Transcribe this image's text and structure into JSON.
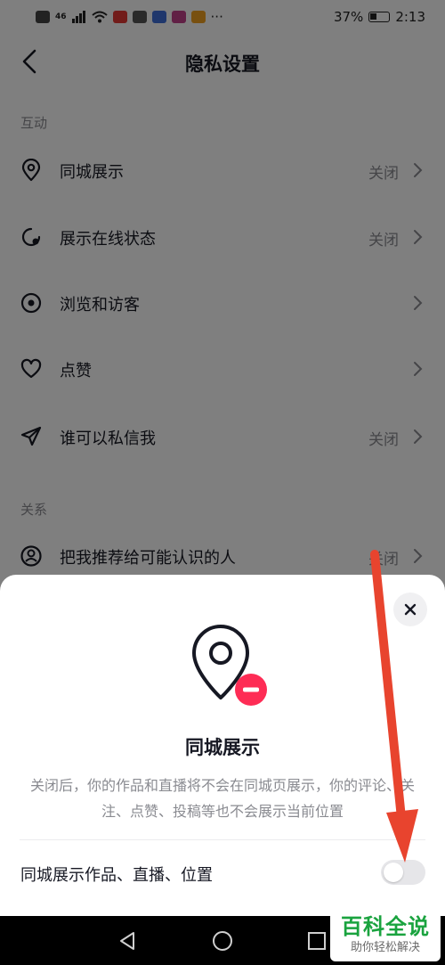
{
  "status_bar": {
    "network": "46",
    "battery": "37%",
    "time": "2:13"
  },
  "nav": {
    "back_icon": "chevron-left-icon",
    "title": "隐私设置"
  },
  "sections": [
    {
      "label": "互动",
      "rows": [
        {
          "icon": "location-pin-icon",
          "label": "同城展示",
          "value": "关闭"
        },
        {
          "icon": "online-status-icon",
          "label": "展示在线状态",
          "value": "关闭"
        },
        {
          "icon": "eye-icon",
          "label": "浏览和访客",
          "value": ""
        },
        {
          "icon": "heart-icon",
          "label": "点赞",
          "value": ""
        },
        {
          "icon": "send-icon",
          "label": "谁可以私信我",
          "value": "关闭"
        }
      ]
    },
    {
      "label": "关系",
      "rows": [
        {
          "icon": "user-circle-icon",
          "label": "把我推荐给可能认识的人",
          "value": "关闭"
        }
      ]
    }
  ],
  "sheet": {
    "close_icon": "close-icon",
    "icon": "location-off-icon",
    "title": "同城展示",
    "description": "关闭后，你的作品和直播将不会在同城页展示，你的评论、关注、点赞、投稿等也不会展示当前位置",
    "toggle_label": "同城展示作品、直播、位置",
    "toggle_on": false
  },
  "system_nav": [
    "back-triangle-icon",
    "home-circle-icon",
    "recents-square-icon"
  ],
  "watermark": {
    "main": "百科全说",
    "sub": "助你轻松解决"
  },
  "colors": {
    "accent_red": "#fe2c55",
    "annotation_arrow": "#e8442e",
    "watermark_green": "#1aa33f"
  }
}
